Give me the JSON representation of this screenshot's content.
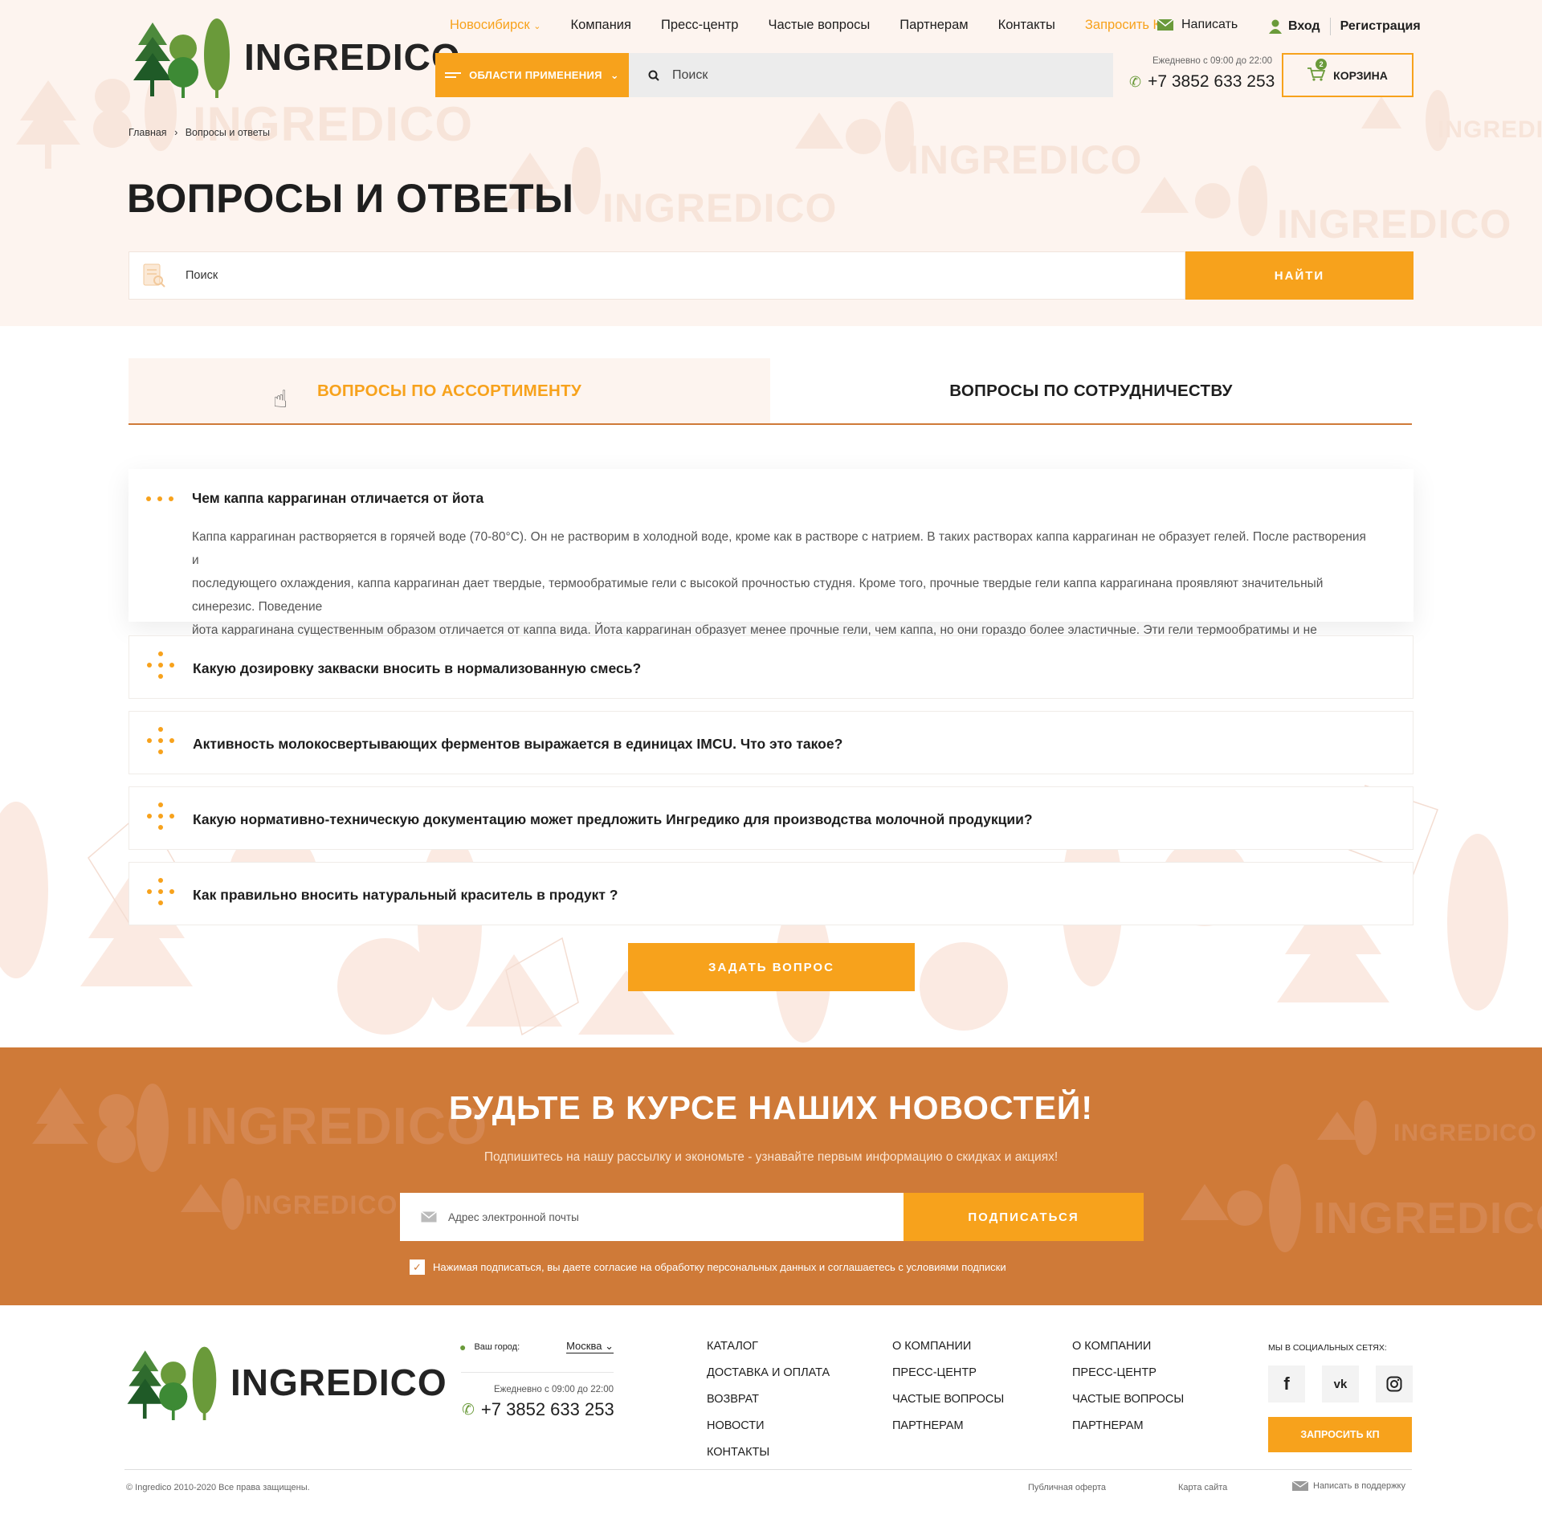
{
  "header": {
    "logo_text": "INGREDICO",
    "city": "Новосибирск",
    "nav": [
      "Компания",
      "Пресс-центр",
      "Частые вопросы",
      "Партнерам",
      "Контакты"
    ],
    "request_kp": "Запросить КП",
    "write": "Написать",
    "login": "Вход",
    "register": "Регистрация",
    "areas_button": "ОБЛАСТИ ПРИМЕНЕНИЯ",
    "search_placeholder": "Поиск",
    "schedule": "Ежедневно с 09:00 до 22:00",
    "phone": "+7 3852 633 253",
    "cart_label": "КОРЗИНА",
    "cart_count": "2"
  },
  "breadcrumb": {
    "home": "Главная",
    "separator": "›",
    "current": "Вопросы и ответы"
  },
  "page": {
    "title": "ВОПРОСЫ И ОТВЕТЫ",
    "search_placeholder": "Поиск",
    "search_button": "НАЙТИ"
  },
  "tabs": [
    {
      "label": "ВОПРОСЫ ПО АССОРТИМЕНТУ",
      "active": true
    },
    {
      "label": "ВОПРОСЫ ПО СОТРУДНИЧЕСТВУ",
      "active": false
    }
  ],
  "faq": [
    {
      "question": "Чем каппа каррагинан отличается от йота",
      "expanded": true,
      "answer": [
        "Каппа каррагинан растворяется в горячей воде (70-80°С). Он не растворим в холодной воде, кроме как в растворе с натрием. В таких растворах каппа каррагинан не образует гелей. После растворения и",
        "последующего охлаждения, каппа каррагинан дает твердые, термообратимые гели с высокой прочностью студня. Кроме того, прочные твердые гели каппа каррагинана проявляют значительный синерезис. Поведение",
        "йота каррагинана существенным образом отличается от каппа вида. Йота каррагинан образует менее прочные гели, чем каппа, но они гораздо более эластичные. Эти гели термообратимы и не проявляют синерезис."
      ]
    },
    {
      "question": "Какую дозировку закваски вносить в нормализованную смесь?",
      "expanded": false
    },
    {
      "question": "Активность молокосвертывающих ферментов выражается в единицах IMCU. Что это такое?",
      "expanded": false
    },
    {
      "question": "Какую нормативно-техническую документацию может предложить Ингредико для производства  молочной продукции?",
      "expanded": false
    },
    {
      "question": "Как правильно вносить натуральный краситель в продукт ?",
      "expanded": false
    }
  ],
  "ask_button": "ЗАДАТЬ ВОПРОС",
  "newsletter": {
    "title": "БУДЬТЕ В КУРСЕ НАШИХ НОВОСТЕЙ!",
    "subtitle": "Подпишитесь на нашу рассылку и экономьте - узнавайте первым информацию о скидках и акциях!",
    "email_placeholder": "Адрес электронной почты",
    "button": "ПОДПИСАТЬСЯ",
    "consent": "Нажимая подписаться, вы даете согласие на обработку персональных данных и соглашаетесь с условиями подписки"
  },
  "footer": {
    "logo_text": "INGREDICO",
    "city_label": "Ваш город:",
    "city": "Москва",
    "schedule": "Ежедневно с 09:00 до 22:00",
    "phone": "+7 3852 633 253",
    "col1": [
      "КАТАЛОГ",
      "ДОСТАВКА И ОПЛАТА",
      "ВОЗВРАТ",
      "НОВОСТИ",
      "КОНТАКТЫ"
    ],
    "col2": [
      "О КОМПАНИИ",
      "ПРЕСС-ЦЕНТР",
      "ЧАСТЫЕ ВОПРОСЫ",
      "ПАРТНЕРАМ"
    ],
    "col3": [
      "О КОМПАНИИ",
      "ПРЕСС-ЦЕНТР",
      "ЧАСТЫЕ ВОПРОСЫ",
      "ПАРТНЕРАМ"
    ],
    "social_label": "МЫ В СОЦИАЛЬНЫХ СЕТЯХ:",
    "social": [
      "f",
      "vk",
      "instagram"
    ],
    "kp_button": "ЗАПРОСИТЬ КП",
    "copyright": "© Ingredico 2010-2020 Все права защищены.",
    "offer": "Публичная оферта",
    "sitemap": "Карта сайта",
    "support": "Написать в поддержку"
  },
  "colors": {
    "accent": "#f7a21c",
    "brand_brown": "#cf7a38",
    "green": "#6a9a3a",
    "bg_light": "#fdf4ef"
  }
}
